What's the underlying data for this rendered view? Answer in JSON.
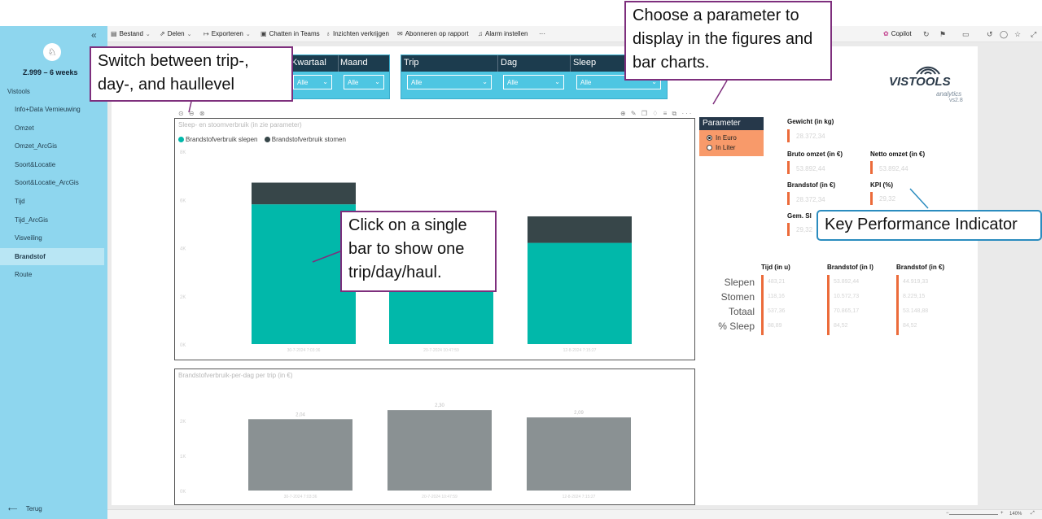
{
  "sidebar": {
    "collapse_glyph": "«",
    "workspace_icon": "bird-icon",
    "title": "Z.999 – 6 weeks",
    "section": "Vistools",
    "items": [
      {
        "label": "Info+Data Vernieuwing"
      },
      {
        "label": "Omzet"
      },
      {
        "label": "Omzet_ArcGis"
      },
      {
        "label": "Soort&Locatie"
      },
      {
        "label": "Soort&Locatie_ArcGis"
      },
      {
        "label": "Tijd"
      },
      {
        "label": "Tijd_ArcGis"
      },
      {
        "label": "Visveiling"
      },
      {
        "label": "Brandstof",
        "active": true
      },
      {
        "label": "Route"
      }
    ],
    "back_label": "Terug"
  },
  "toolbar": {
    "items": [
      {
        "label": "Bestand"
      },
      {
        "label": "Delen"
      },
      {
        "label": "Exporteren"
      },
      {
        "label": "Chatten in Teams"
      },
      {
        "label": "Inzichten verkrijgen"
      },
      {
        "label": "Abonneren op rapport"
      },
      {
        "label": "Alarm instellen"
      },
      {
        "label": "···"
      }
    ],
    "copilot_label": "Copilot"
  },
  "slicers": {
    "kwartaal": {
      "header": "Kwartaal",
      "value": "Alle"
    },
    "maand": {
      "header": "Maand",
      "value": "Alle"
    },
    "trip": {
      "header": "Trip",
      "value": "Alle"
    },
    "dag": {
      "header": "Dag",
      "value": "Alle"
    },
    "sleep": {
      "header": "Sleep",
      "value": "Alle"
    }
  },
  "parameter": {
    "header": "Parameter",
    "options": [
      {
        "label": "In Euro",
        "selected": true
      },
      {
        "label": "In Liter",
        "selected": false
      }
    ]
  },
  "kpis": {
    "gewicht": {
      "label": "Gewicht (in kg)",
      "value": "28.372,34"
    },
    "bruto": {
      "label": "Bruto omzet (in €)",
      "value": "53.892,44"
    },
    "netto": {
      "label": "Netto omzet (in €)",
      "value": "53.892,44"
    },
    "brandstof": {
      "label": "Brandstof (in €)",
      "value": "28.372,34"
    },
    "kpi": {
      "label": "KPI (%)",
      "value": "29,32"
    },
    "gem": {
      "label": "Gem. Sl",
      "value": "29,32"
    }
  },
  "table": {
    "headers": [
      "Tijd (in u)",
      "Brandstof (in l)",
      "Brandstof (in €)"
    ],
    "rows": [
      {
        "label": "Slepen",
        "values": [
          "483,21",
          "53.892,44",
          "44.919,33"
        ]
      },
      {
        "label": "Stomen",
        "values": [
          "118,16",
          "10.572,73",
          "8.229,15"
        ]
      },
      {
        "label": "Totaal",
        "values": [
          "537,36",
          "70.865,17",
          "53.148,88"
        ]
      },
      {
        "label": "% Sleep",
        "values": [
          "88,89",
          "84,52",
          "84,52"
        ]
      }
    ]
  },
  "branding": {
    "name_left": "VIS",
    "name_right": "TOOLS",
    "sub": "analytics",
    "version": "vs2.8"
  },
  "chart_data": [
    {
      "type": "bar",
      "stacked": true,
      "title": "Sleep- en stoomverbruik (in zie parameter)",
      "categories": [
        "30-7-2024 7:03:36",
        "20-7-2024 10:47:59",
        "12-8-2024 7:15:27"
      ],
      "series": [
        {
          "name": "Brandstofverbruik slepen",
          "color": "#01b8aa",
          "values": [
            5.8,
            4.4,
            4.2
          ]
        },
        {
          "name": "Brandstofverbruik stomen",
          "color": "#374649",
          "values": [
            0.9,
            0.5,
            1.1
          ]
        }
      ],
      "ylim": [
        0,
        8
      ],
      "yticks": [
        "0K",
        "2K",
        "4K",
        "6K",
        "8K"
      ]
    },
    {
      "type": "bar",
      "title": "Brandstofverbruik-per-dag per trip (in €)",
      "categories": [
        "30-7-2024 7:03:36",
        "20-7-2024 10:47:59",
        "12-8-2024 7:15:27"
      ],
      "series": [
        {
          "color": "#8a9193",
          "values": [
            2.04,
            2.3,
            2.09
          ],
          "labels": [
            "2,04",
            "2,30",
            "2,09"
          ]
        }
      ],
      "ylim": [
        0,
        3
      ],
      "yticks": [
        "0K",
        "1K",
        "2K"
      ]
    }
  ],
  "callouts": {
    "slicer_hint": "Switch between trip-, day-, and haullevel",
    "parameter_hint": "Choose a parameter to display in the figures and bar charts.",
    "bar_hint": "Click on a single bar to show one trip/day/haul.",
    "kpi_hint": "Key Performance Indicator"
  },
  "statusbar": {
    "zoom": "140%"
  }
}
